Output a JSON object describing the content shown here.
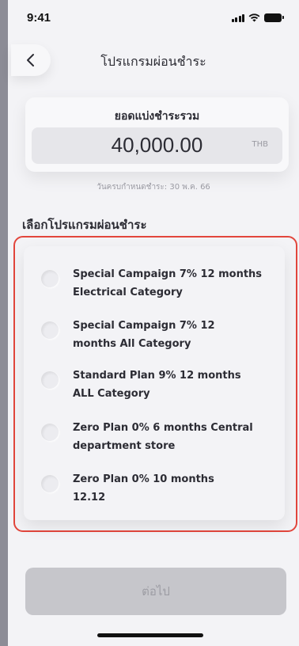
{
  "status_bar": {
    "time": "9:41"
  },
  "header": {
    "title": "โปรแกรมผ่อนชำระ"
  },
  "summary": {
    "label": "ยอดแบ่งชำระรวม",
    "amount": "40,000.00",
    "currency": "THB",
    "due_text": "วันครบกำหนดชำระ: 30 พ.ค. 66"
  },
  "section_title": "เลือกโปรแกรมผ่อนชำระ",
  "options": [
    {
      "line1": "Special Campaign 7% 12 months",
      "line2": "Electrical Category",
      "selected": false
    },
    {
      "line1": "Special Campaign 7% 12",
      "line2": "months All Category",
      "selected": false
    },
    {
      "line1": "Standard Plan 9% 12 months",
      "line2": "ALL Category",
      "selected": false
    },
    {
      "line1": "Zero Plan 0% 6 months Central",
      "line2": "department store",
      "selected": false
    },
    {
      "line1": "Zero Plan 0% 10 months",
      "line2": "12.12",
      "selected": false
    }
  ],
  "footer": {
    "next_label": "ต่อไป"
  },
  "colors": {
    "highlight": "#e2463c",
    "disabled_button": "#c6c6cb"
  },
  "icons": {
    "back": "chevron-left-icon"
  }
}
